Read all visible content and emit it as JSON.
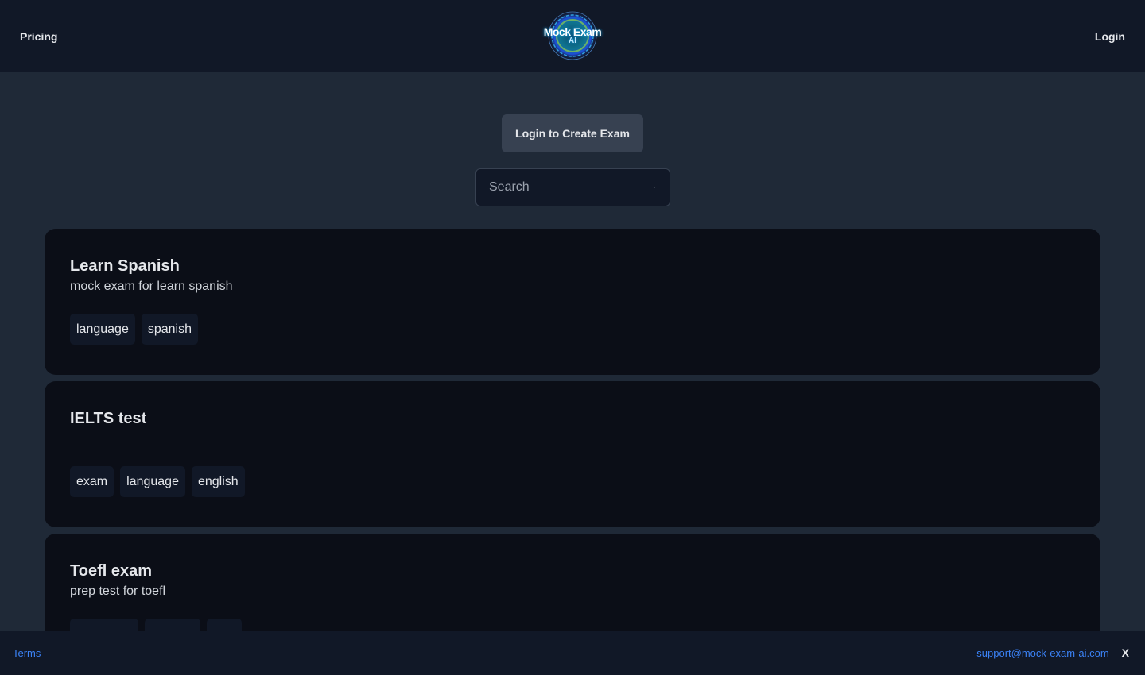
{
  "navbar": {
    "pricing_label": "Pricing",
    "login_label": "Login",
    "logo": {
      "line1": "Mock Exam",
      "line2": "AI"
    }
  },
  "main": {
    "create_button_label": "Login to Create Exam",
    "search": {
      "placeholder": "Search",
      "value": "",
      "icon": "search-icon"
    },
    "exams": [
      {
        "title": "Learn Spanish",
        "description": "mock exam for learn spanish",
        "tags": [
          "language",
          "spanish"
        ]
      },
      {
        "title": "IELTS test",
        "description": "",
        "tags": [
          "exam",
          "language",
          "english"
        ]
      },
      {
        "title": "Toefl exam",
        "description": "prep test for toefl",
        "tags": [
          "",
          "",
          ""
        ]
      }
    ]
  },
  "footer": {
    "terms_label": "Terms",
    "support_email": "support@mock-exam-ai.com",
    "close_label": "X"
  },
  "colors": {
    "page_bg": "#1f2937",
    "navbar_bg": "#111827",
    "card_bg": "#0b0e17",
    "button_bg": "#374151",
    "link_blue": "#3b82f6"
  }
}
